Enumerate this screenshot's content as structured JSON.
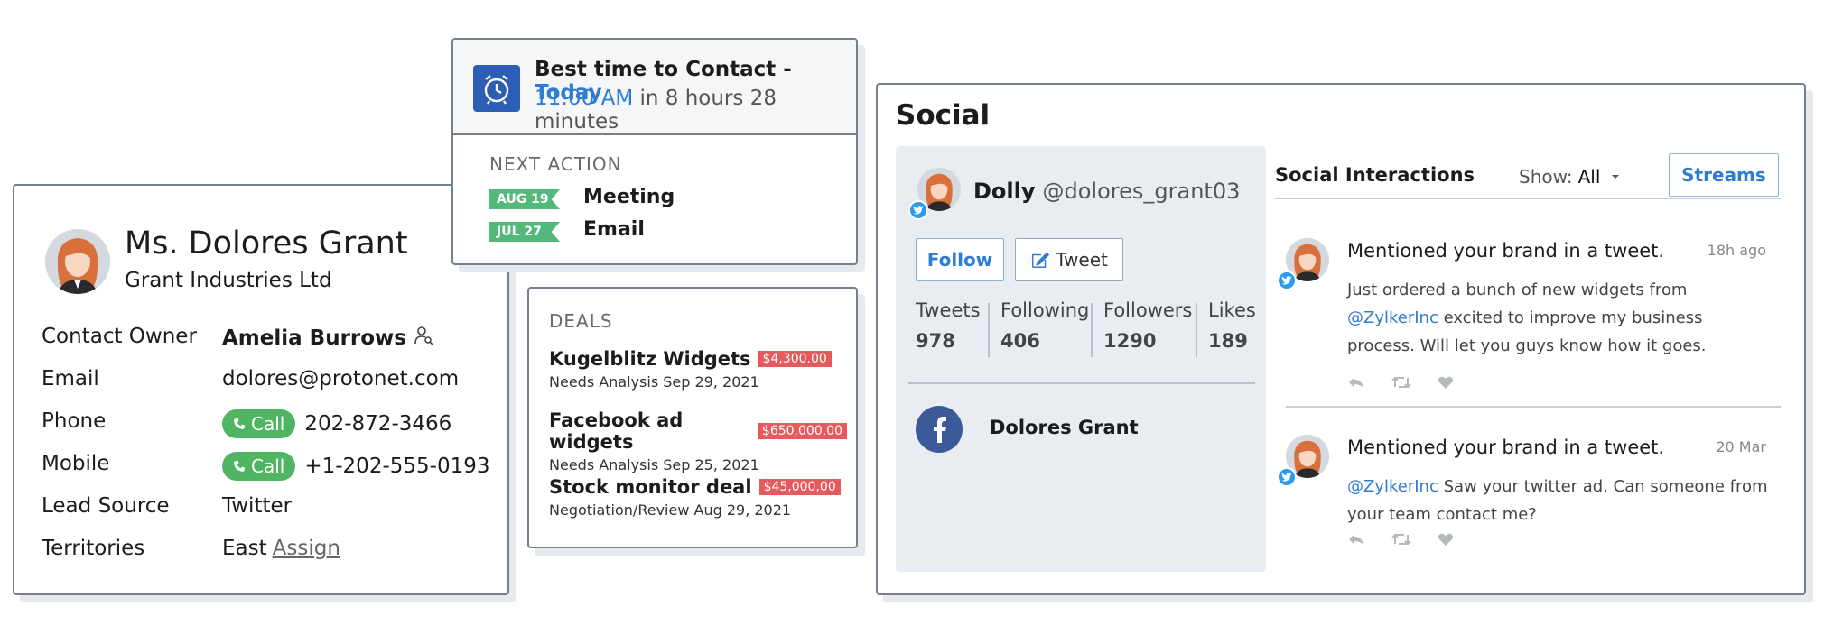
{
  "contact": {
    "name": "Ms. Dolores Grant",
    "company": "Grant Industries Ltd",
    "fields": [
      {
        "label": "Contact Owner",
        "value": "Amelia Burrows"
      },
      {
        "label": "Email",
        "value": "dolores@protonet.com"
      },
      {
        "label": "Phone",
        "value": "202-872-3466"
      },
      {
        "label": "Mobile",
        "value": "+1-202-555-0193"
      },
      {
        "label": "Lead Source",
        "value": "Twitter"
      },
      {
        "label": "Territories",
        "value": "East"
      }
    ],
    "call_label": "Call",
    "assign_label": "Assign"
  },
  "best_time": {
    "title": "Best time to Contact - ",
    "day": "Today",
    "time": "11:00 AM",
    "relative": " in 8 hours 28 minutes"
  },
  "next_action": {
    "heading": "NEXT ACTION",
    "items": [
      {
        "date": "AUG 19",
        "label": "Meeting"
      },
      {
        "date": "JUL 27",
        "label": "Email"
      }
    ]
  },
  "deals": {
    "heading": "DEALS",
    "items": [
      {
        "name": "Kugelblitz Widgets",
        "amount": "$4,300.00",
        "stage": "Needs Analysis",
        "date": "Sep 29, 2021"
      },
      {
        "name": "Facebook ad widgets",
        "amount": "$650,000,00",
        "stage": "Needs Analysis",
        "date": "Sep 25, 2021"
      },
      {
        "name": "Stock monitor deal",
        "amount": "$45,000,00",
        "stage": "Negotiation/Review",
        "date": "Aug 29, 2021"
      }
    ]
  },
  "social": {
    "title": "Social",
    "profile": {
      "name": "Dolly",
      "handle": "@dolores_grant03",
      "follow_label": "Follow",
      "tweet_label": "Tweet",
      "stats": [
        {
          "label": "Tweets",
          "value": "978"
        },
        {
          "label": "Following",
          "value": "406"
        },
        {
          "label": "Followers",
          "value": "1290"
        },
        {
          "label": "Likes",
          "value": "189"
        }
      ],
      "facebook_name": "Dolores Grant"
    },
    "interactions_title": "Social Interactions",
    "show_label": "Show:",
    "show_value": "All",
    "streams_label": "Streams",
    "interactions": [
      {
        "title": "Mentioned your brand in a tweet.",
        "time": "18h ago",
        "pre": "Just ordered a bunch of new widgets from ",
        "mention": "@ZylkerInc",
        "post": " excited to improve my business process. Will let you guys know how it goes."
      },
      {
        "title": "Mentioned your brand in a tweet.",
        "time": "20 Mar",
        "pre": "",
        "mention": "@ZylkerInc",
        "post": " Saw your twitter ad. Can someone from your team contact me?"
      }
    ]
  },
  "colors": {
    "accent_blue": "#2f7cd3",
    "call_green": "#4fb563",
    "date_green": "#53b97a",
    "deal_red": "#e55a5c",
    "alarm_blue": "#2d5db5",
    "twitter_blue": "#2b9af0",
    "facebook_blue": "#3b5a9a"
  },
  "icons": [
    "alarm-clock-icon",
    "phone-icon",
    "owner-search-icon",
    "twitter-icon",
    "facebook-icon",
    "compose-icon",
    "caret-down-icon",
    "reply-icon",
    "retweet-icon",
    "heart-icon"
  ]
}
